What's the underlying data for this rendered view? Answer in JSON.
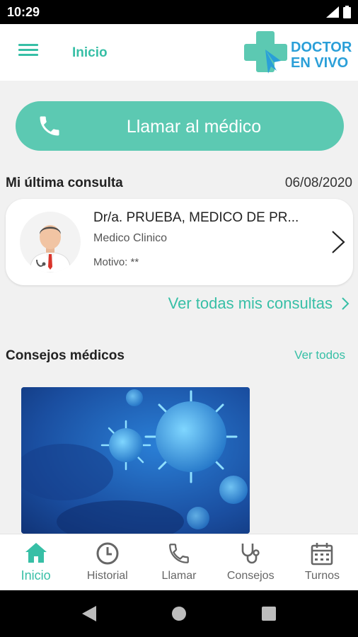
{
  "status_bar": {
    "time": "10:29"
  },
  "app_bar": {
    "title": "Inicio",
    "logo_line1": "DOCTOR",
    "logo_line2": "EN VIVO"
  },
  "call_button": {
    "label": "Llamar al médico"
  },
  "last_consultation": {
    "title": "Mi última consulta",
    "date": "06/08/2020",
    "doctor": "Dr/a. PRUEBA, MEDICO DE PR...",
    "specialty": "Medico Clinico",
    "reason": "Motivo: **",
    "see_all": "Ver todas mis consultas"
  },
  "tips": {
    "title": "Consejos médicos",
    "see_all": "Ver todos"
  },
  "bottom_nav": [
    {
      "label": "Inicio",
      "icon": "home-icon",
      "active": true
    },
    {
      "label": "Historial",
      "icon": "clock-icon",
      "active": false
    },
    {
      "label": "Llamar",
      "icon": "phone-icon",
      "active": false
    },
    {
      "label": "Consejos",
      "icon": "stethoscope-icon",
      "active": false
    },
    {
      "label": "Turnos",
      "icon": "calendar-icon",
      "active": false
    }
  ],
  "colors": {
    "accent": "#37bfa6",
    "call_button": "#5cc9b2",
    "logo_blue": "#2a9fd8"
  }
}
